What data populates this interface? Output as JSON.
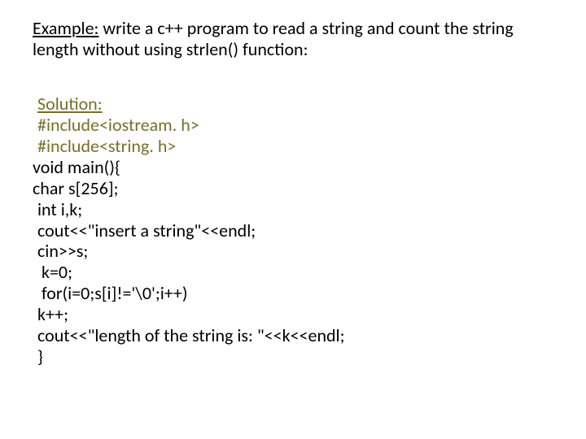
{
  "example": {
    "label": "Example:",
    "text_rest": " write a c++ program to read a string and count the string length without using strlen() function:"
  },
  "solution": {
    "label": "Solution:",
    "lines": {
      "l1": "#include<iostream. h>",
      "l2": "#include<string. h>",
      "l3": "void main(){",
      "l4": "char s[256];",
      "l5": "int i,k;",
      "l6": "cout<<\"insert a string\"<<endl;",
      "l7": "cin>>s;",
      "l8": " k=0;",
      "l9": " for(i=0;s[i]!='\\0';i++)",
      "l10": "k++;",
      "l11": "cout<<\"length of the string is: \"<<k<<endl;",
      "l12": "}"
    }
  }
}
